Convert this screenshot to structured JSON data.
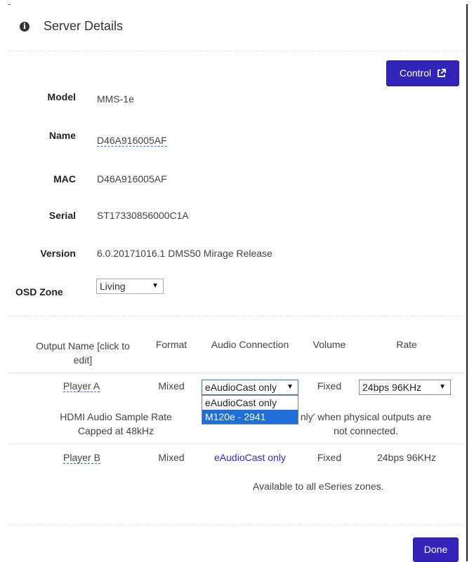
{
  "header": {
    "title": "Server Details",
    "icon": "info-circle-icon"
  },
  "control_button": {
    "label": "Control",
    "icon": "external-link-icon"
  },
  "details": {
    "model_label": "Model",
    "model_value": "MMS-1e",
    "name_label": "Name",
    "name_value": "D46A916005AF",
    "mac_label": "MAC",
    "mac_value": "D46A916005AF",
    "serial_label": "Serial",
    "serial_value": "ST17330856000C1A",
    "version_label": "Version",
    "version_value": "6.0.20171016.1 DMS50 Mirage Release",
    "osd_zone_label": "OSD Zone",
    "osd_zone_value": "Living"
  },
  "outputs_table": {
    "headers": {
      "output_name_line1": "Output Name [click to",
      "output_name_line2": "edit]",
      "format": "Format",
      "audio_connection": "Audio Connection",
      "volume": "Volume",
      "rate": "Rate"
    },
    "rows": [
      {
        "name": "Player A",
        "format": "Mixed",
        "audio_connection": "eAudioCast only",
        "volume": "Fixed",
        "rate": "24bps 96KHz"
      },
      {
        "name": "Player B",
        "format": "Mixed",
        "audio_connection": "eAudioCast only",
        "volume": "Fixed",
        "rate": "24bps 96KHz"
      }
    ],
    "audio_dropdown_options": [
      "eAudioCast only",
      "M120e - 2941"
    ],
    "audio_dropdown_highlighted": "M120e - 2941",
    "note_left_line1": "HDMI Audio Sample Rate",
    "note_left_line2": "Capped at 48kHz",
    "note_right_line1": "nly' when physical outputs are",
    "note_right_line2": "not connected.",
    "available_note": "Available to all eSeries zones."
  },
  "done_button": {
    "label": "Done"
  },
  "colors": {
    "primary_button": "#3224b8",
    "link": "#3b28b8",
    "highlight": "#1e6fd8"
  }
}
